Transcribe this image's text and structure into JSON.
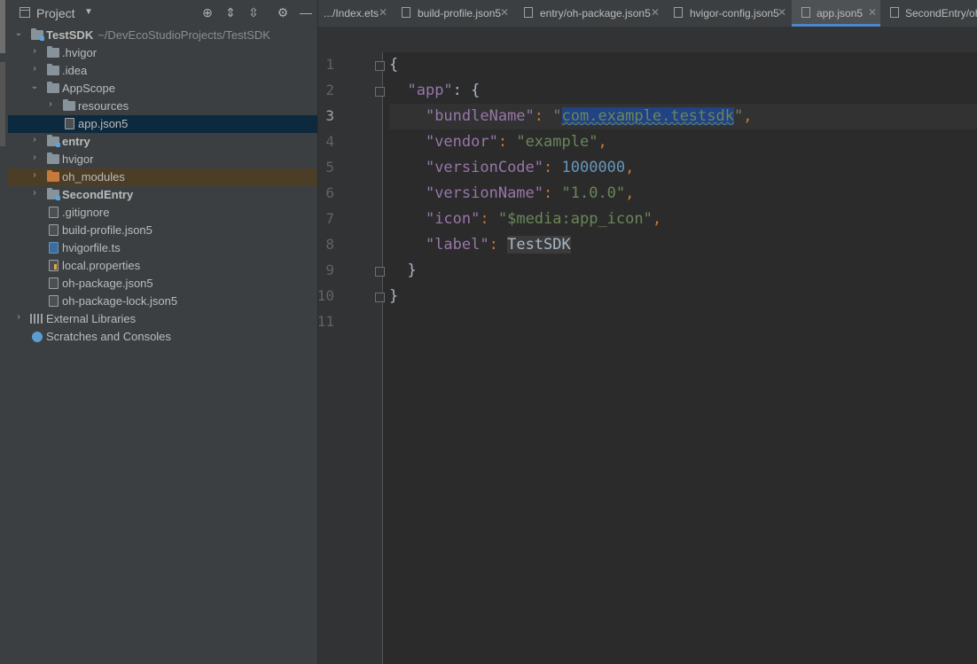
{
  "panel": {
    "title": "Project",
    "tree": [
      {
        "label": "TestSDK",
        "path": "~/DevEcoStudioProjects/TestSDK",
        "bold": true
      },
      {
        "label": ".hvigor"
      },
      {
        "label": ".idea"
      },
      {
        "label": "AppScope"
      },
      {
        "label": "resources"
      },
      {
        "label": "app.json5"
      },
      {
        "label": "entry",
        "bold": true
      },
      {
        "label": "hvigor"
      },
      {
        "label": "oh_modules"
      },
      {
        "label": "SecondEntry",
        "bold": true
      },
      {
        "label": ".gitignore"
      },
      {
        "label": "build-profile.json5"
      },
      {
        "label": "hvigorfile.ts"
      },
      {
        "label": "local.properties"
      },
      {
        "label": "oh-package.json5"
      },
      {
        "label": "oh-package-lock.json5"
      },
      {
        "label": "External Libraries"
      },
      {
        "label": "Scratches and Consoles"
      }
    ]
  },
  "tabs": [
    {
      "label": ".../Index.ets"
    },
    {
      "label": "build-profile.json5"
    },
    {
      "label": "entry/oh-package.json5"
    },
    {
      "label": "hvigor-config.json5"
    },
    {
      "label": "app.json5",
      "active": true
    },
    {
      "label": "SecondEntry/oh"
    }
  ],
  "editor": {
    "line_numbers": [
      "1",
      "2",
      "3",
      "4",
      "5",
      "6",
      "7",
      "8",
      "9",
      "10",
      "11"
    ],
    "current_line": 3,
    "code": {
      "l1_brace": "{",
      "l2_key": "\"app\"",
      "l2_rest": ": {",
      "l3_key": "\"bundleName\"",
      "l3_colon": ": ",
      "l3_q1": "\"",
      "l3_sel": "com.example.testsdk",
      "l3_q2": "\"",
      "l3_comma": ",",
      "l4_key": "\"vendor\"",
      "l4_colon": ": ",
      "l4_val": "\"example\"",
      "l4_comma": ",",
      "l5_key": "\"versionCode\"",
      "l5_colon": ": ",
      "l5_val": "1000000",
      "l5_comma": ",",
      "l6_key": "\"versionName\"",
      "l6_colon": ": ",
      "l6_val": "\"1.0.0\"",
      "l6_comma": ",",
      "l7_key": "\"icon\"",
      "l7_colon": ": ",
      "l7_val": "\"$media:app_icon\"",
      "l7_comma": ",",
      "l8_key": "\"label\"",
      "l8_colon": ": ",
      "l8_val": "TestSDK",
      "l9_brace": "}",
      "l10_brace": "}"
    }
  },
  "colors": {
    "background": "#2b2b2b",
    "panel": "#3c3f41",
    "selection": "#214283",
    "tree_selected": "#0d293e",
    "excluded": "#4c3d26",
    "keyword": "#9876aa",
    "string": "#6a8759",
    "number": "#6897bb",
    "punctuation": "#cc7832"
  }
}
